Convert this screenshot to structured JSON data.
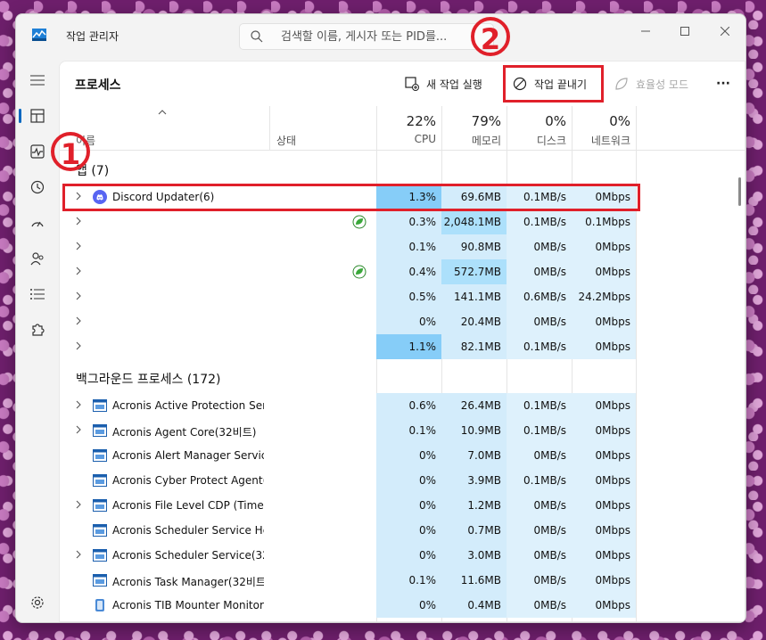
{
  "window": {
    "title": "작업 관리자",
    "search_placeholder": "검색할 이름, 게시자 또는 PID를..."
  },
  "toolbar": {
    "page_title": "프로세스",
    "run_new_task": "새 작업 실행",
    "end_task": "작업 끝내기",
    "efficiency_mode": "효율성 모드",
    "more": "···"
  },
  "annotations": {
    "badge1": "1",
    "badge2": "2"
  },
  "columns": {
    "name": "이름",
    "status": "상태",
    "cpu": {
      "pct": "22%",
      "label": "CPU"
    },
    "memory": {
      "pct": "79%",
      "label": "메모리"
    },
    "disk": {
      "pct": "0%",
      "label": "디스크"
    },
    "network": {
      "pct": "0%",
      "label": "네트워크"
    }
  },
  "apps": {
    "label": "앱 (7)",
    "rows": [
      {
        "name": "Discord Updater(6)",
        "cpu": "1.3%",
        "mem": "69.6MB",
        "disk": "0.1MB/s",
        "net": "0Mbps"
      },
      {
        "name": "",
        "cpu": "0.3%",
        "mem": "2,048.1MB",
        "disk": "0.1MB/s",
        "net": "0.1Mbps"
      },
      {
        "name": "",
        "cpu": "0.1%",
        "mem": "90.8MB",
        "disk": "0MB/s",
        "net": "0Mbps"
      },
      {
        "name": "",
        "cpu": "0.4%",
        "mem": "572.7MB",
        "disk": "0MB/s",
        "net": "0Mbps"
      },
      {
        "name": "",
        "cpu": "0.5%",
        "mem": "141.1MB",
        "disk": "0.6MB/s",
        "net": "24.2Mbps"
      },
      {
        "name": "",
        "cpu": "0%",
        "mem": "20.4MB",
        "disk": "0MB/s",
        "net": "0Mbps"
      },
      {
        "name": "",
        "cpu": "1.1%",
        "mem": "82.1MB",
        "disk": "0.1MB/s",
        "net": "0Mbps"
      }
    ]
  },
  "background": {
    "label": "백그라운드 프로세스 (172)",
    "rows": [
      {
        "name": "Acronis Active Protection Ser...",
        "cpu": "0.6%",
        "mem": "26.4MB",
        "disk": "0.1MB/s",
        "net": "0Mbps"
      },
      {
        "name": "Acronis Agent Core(32비트)",
        "cpu": "0.1%",
        "mem": "10.9MB",
        "disk": "0.1MB/s",
        "net": "0Mbps"
      },
      {
        "name": "Acronis Alert Manager Servic...",
        "cpu": "0%",
        "mem": "7.0MB",
        "disk": "0MB/s",
        "net": "0Mbps"
      },
      {
        "name": "Acronis Cyber Protect Agent(...",
        "cpu": "0%",
        "mem": "3.9MB",
        "disk": "0.1MB/s",
        "net": "0Mbps"
      },
      {
        "name": "Acronis File Level CDP (Time ...",
        "cpu": "0%",
        "mem": "1.2MB",
        "disk": "0MB/s",
        "net": "0Mbps"
      },
      {
        "name": "Acronis Scheduler Service He...",
        "cpu": "0%",
        "mem": "0.7MB",
        "disk": "0MB/s",
        "net": "0Mbps"
      },
      {
        "name": "Acronis Scheduler Service(32...",
        "cpu": "0%",
        "mem": "3.0MB",
        "disk": "0MB/s",
        "net": "0Mbps"
      },
      {
        "name": "Acronis Task Manager(32비트)",
        "cpu": "0.1%",
        "mem": "11.6MB",
        "disk": "0MB/s",
        "net": "0Mbps"
      },
      {
        "name": "Acronis TIB Mounter Monitor...",
        "cpu": "0%",
        "mem": "0.4MB",
        "disk": "0MB/s",
        "net": "0Mbps"
      }
    ]
  },
  "colors": {
    "accent": "#0067c0",
    "annotation_red": "#e0202a",
    "heat_light": "#d3ecfb",
    "heat_strong": "#86cdf8"
  }
}
